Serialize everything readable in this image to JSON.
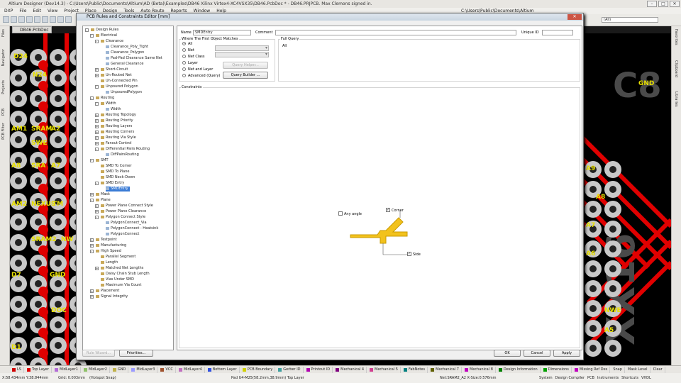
{
  "app": {
    "title": "Altium Designer (Dev14.3) - C:\\Users\\Public\\Documents\\Altium\\AD (Beta)\\Examples\\DB46 Xilinx Virtex4-XC4VSX35\\DB46.PcbDoc * - DB46.PRJPCB. Max Clemons signed in."
  },
  "menu": {
    "items": [
      "DXP",
      "File",
      "Edit",
      "View",
      "Project",
      "Place",
      "Design",
      "Tools",
      "Auto Route",
      "Reports",
      "Window",
      "Help"
    ],
    "path": "C:\\Users\\Public\\Documents\\Altium",
    "filter": "(All)"
  },
  "doc_tab": "DB46.PcbDoc *",
  "left_panels": [
    "Files",
    "Navigator",
    "Projects",
    "PCB",
    "PCB Filter"
  ],
  "right_panels": [
    "Favorites",
    "Clipboard",
    "Libraries"
  ],
  "pcb_labels": [
    "D24",
    "N24",
    "AM1",
    "SRAM",
    "A2",
    "SWE",
    "A8",
    "SRA",
    "A7",
    "AM2",
    "NEXUS",
    "TM",
    "SRAM2",
    "NW",
    "D7",
    "GND",
    "DOC",
    "D1",
    "A9",
    "A8",
    "A7",
    "A6",
    "NWE",
    "A5",
    "GND",
    "C8",
    "XX16"
  ],
  "dialog": {
    "title": "PCB Rules and Constraints Editor [mm]",
    "name_label": "Name",
    "name_value": "SMDEntry",
    "comment_label": "Comment",
    "comment_value": "",
    "uid_label": "Unique ID",
    "uid_value": "",
    "where_title": "Where The First Object Matches",
    "options": [
      "All",
      "Net",
      "Net Class",
      "Layer",
      "Net and Layer",
      "Advanced (Query)"
    ],
    "selected_option": "All",
    "query_helper": "Query Helper...",
    "query_builder": "Query Builder ...",
    "full_query_title": "Full Query",
    "full_query_value": "All",
    "constraints_title": "Constraints",
    "any_angle": "Any angle",
    "corner": "Corner",
    "side": "Side",
    "any_angle_checked": false,
    "corner_checked": true,
    "side_checked": true,
    "rule_wizard": "Rule Wizard...",
    "priorities": "Priorities...",
    "ok": "OK",
    "cancel": "Cancel",
    "apply": "Apply"
  },
  "tree": [
    {
      "label": "Design Rules",
      "level": 0,
      "exp": "-"
    },
    {
      "label": "Electrical",
      "level": 1,
      "exp": "-"
    },
    {
      "label": "Clearance",
      "level": 2,
      "exp": "-"
    },
    {
      "label": "Clearance_Poly_Tight",
      "level": 3
    },
    {
      "label": "Clearance_Polygon",
      "level": 3
    },
    {
      "label": "Pad-Pad Clearance Same Net",
      "level": 3
    },
    {
      "label": "General Clearance",
      "level": 3
    },
    {
      "label": "Short-Circuit",
      "level": 2,
      "exp": "+"
    },
    {
      "label": "Un-Routed Net",
      "level": 2,
      "exp": "+"
    },
    {
      "label": "Un-Connected Pin",
      "level": 2
    },
    {
      "label": "Unpoured Polygon",
      "level": 2,
      "exp": "-"
    },
    {
      "label": "UnpouredPolygon",
      "level": 3
    },
    {
      "label": "Routing",
      "level": 1,
      "exp": "-"
    },
    {
      "label": "Width",
      "level": 2,
      "exp": "-"
    },
    {
      "label": "Width",
      "level": 3
    },
    {
      "label": "Routing Topology",
      "level": 2,
      "exp": "+"
    },
    {
      "label": "Routing Priority",
      "level": 2,
      "exp": "+"
    },
    {
      "label": "Routing Layers",
      "level": 2,
      "exp": "+"
    },
    {
      "label": "Routing Corners",
      "level": 2,
      "exp": "+"
    },
    {
      "label": "Routing Via Style",
      "level": 2,
      "exp": "+"
    },
    {
      "label": "Fanout Control",
      "level": 2,
      "exp": "+"
    },
    {
      "label": "Differential Pairs Routing",
      "level": 2,
      "exp": "-"
    },
    {
      "label": "DiffPairsRouting",
      "level": 3
    },
    {
      "label": "SMT",
      "level": 1,
      "exp": "-"
    },
    {
      "label": "SMD To Corner",
      "level": 2
    },
    {
      "label": "SMD To Plane",
      "level": 2
    },
    {
      "label": "SMD Neck-Down",
      "level": 2
    },
    {
      "label": "SMD Entry",
      "level": 2,
      "exp": "-"
    },
    {
      "label": "SMDEntry",
      "level": 3,
      "selected": true
    },
    {
      "label": "Mask",
      "level": 1,
      "exp": "+"
    },
    {
      "label": "Plane",
      "level": 1,
      "exp": "-"
    },
    {
      "label": "Power Plane Connect Style",
      "level": 2,
      "exp": "+"
    },
    {
      "label": "Power Plane Clearance",
      "level": 2,
      "exp": "+"
    },
    {
      "label": "Polygon Connect Style",
      "level": 2,
      "exp": "-"
    },
    {
      "label": "PolygonConnect_Via",
      "level": 3
    },
    {
      "label": "PolygonConnect - Heatsink",
      "level": 3
    },
    {
      "label": "PolygonConnect",
      "level": 3
    },
    {
      "label": "Testpoint",
      "level": 1,
      "exp": "+"
    },
    {
      "label": "Manufacturing",
      "level": 1,
      "exp": "+"
    },
    {
      "label": "High Speed",
      "level": 1,
      "exp": "-"
    },
    {
      "label": "Parallel Segment",
      "level": 2
    },
    {
      "label": "Length",
      "level": 2
    },
    {
      "label": "Matched Net Lengths",
      "level": 2,
      "exp": "+"
    },
    {
      "label": "Daisy Chain Stub Length",
      "level": 2
    },
    {
      "label": "Vias Under SMD",
      "level": 2
    },
    {
      "label": "Maximum Via Count",
      "level": 2
    },
    {
      "label": "Placement",
      "level": 1,
      "exp": "+"
    },
    {
      "label": "Signal Integrity",
      "level": 1,
      "exp": "+"
    }
  ],
  "layers": [
    {
      "name": "LS",
      "color": "#d00000"
    },
    {
      "name": "Top Layer",
      "color": "#e00000"
    },
    {
      "name": "MidLayer1",
      "color": "#b36bd8"
    },
    {
      "name": "MidLayer2",
      "color": "#8fc26a"
    },
    {
      "name": "GND",
      "color": "#c0b24a"
    },
    {
      "name": "MidLayer3",
      "color": "#9b9bff"
    },
    {
      "name": "VCC",
      "color": "#a0522d"
    },
    {
      "name": "MidLayer4",
      "color": "#c070c0"
    },
    {
      "name": "Bottom Layer",
      "color": "#3050e0"
    },
    {
      "name": "PCB Boundary",
      "color": "#d0d000"
    },
    {
      "name": "Gerber ID",
      "color": "#40a0a0"
    },
    {
      "name": "Printout ID",
      "color": "#b000b0"
    },
    {
      "name": "Mechanical 4",
      "color": "#800080"
    },
    {
      "name": "Mechanical 5",
      "color": "#d04090"
    },
    {
      "name": "FabNotes",
      "color": "#008080"
    },
    {
      "name": "Mechanical 7",
      "color": "#606000"
    },
    {
      "name": "Mechanical 8",
      "color": "#c000c0"
    },
    {
      "name": "Design Information",
      "color": "#008000"
    },
    {
      "name": "Dimensions",
      "color": "#00a000"
    },
    {
      "name": "Missing Ref Des",
      "color": "#c000c0"
    }
  ],
  "status_right": [
    "Snap",
    "Mask Level",
    "Clear"
  ],
  "bottom": {
    "coords": "X:58.434mm Y:38.844mm",
    "grid": "Grid: 0.003mm",
    "snap": "(Hotspot Snap)",
    "pad": "Pad U4-M25(58.2mm,38.9mm) Top Layer",
    "net": "Net:SRAM2_A2 X-Size:0.576mm",
    "panels": [
      "System",
      "Design Compiler",
      "PCB",
      "Instruments",
      "Shortcuts",
      "VHDL"
    ]
  }
}
